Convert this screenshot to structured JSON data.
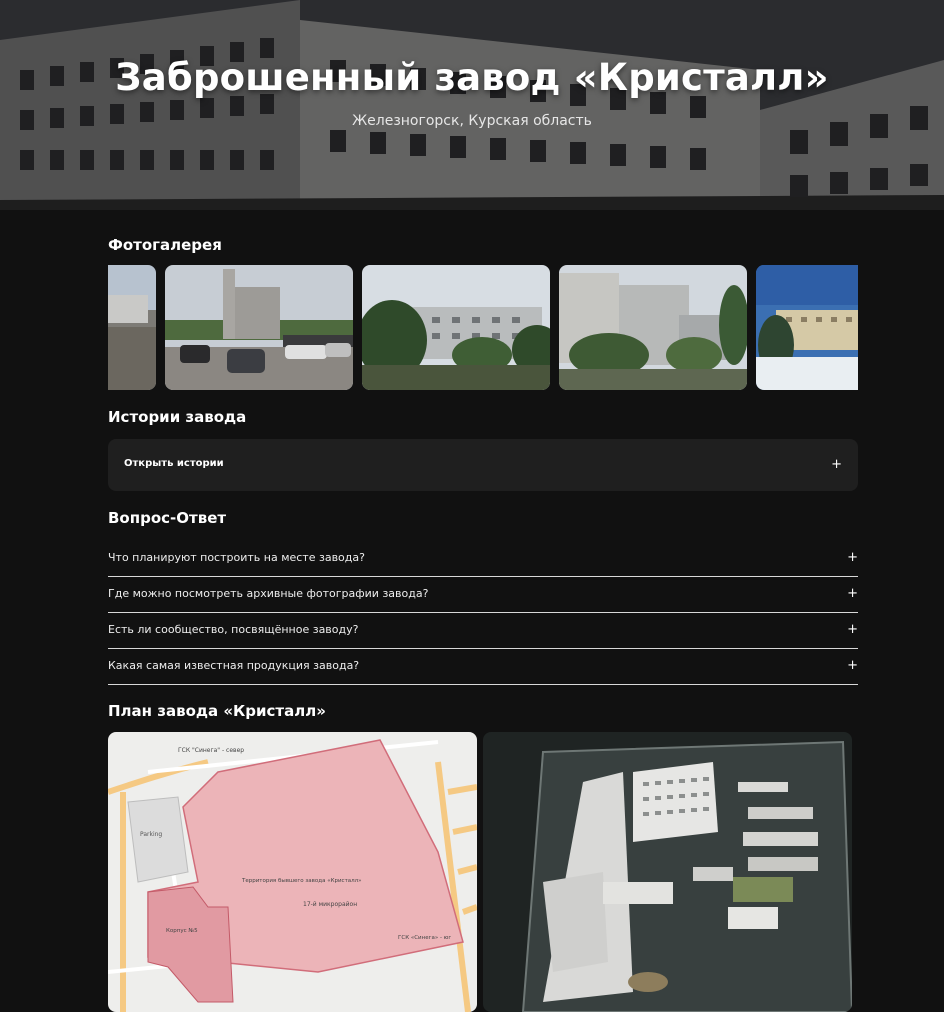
{
  "hero": {
    "title": "Заброшенный завод «Кристалл»",
    "subtitle": "Железногорск, Курская область"
  },
  "gallery": {
    "title": "Фотогалерея",
    "photos": [
      "factory-ruins-photo",
      "parking-rubble-photo",
      "factory-panorama-photo",
      "factory-bushes-photo",
      "factory-winter-photo"
    ]
  },
  "stories": {
    "title": "Истории завода",
    "open_label": "Открыть истории",
    "toggle": "+"
  },
  "faq": {
    "title": "Вопрос-Ответ",
    "items": [
      {
        "question": "Что планируют построить на месте завода?",
        "toggle": "+"
      },
      {
        "question": "Где можно посмотреть архивные фотографии завода?",
        "toggle": "+"
      },
      {
        "question": "Есть ли сообщество, посвящённое заводу?",
        "toggle": "+"
      },
      {
        "question": "Какая самая известная продукция завода?",
        "toggle": "+"
      }
    ]
  },
  "plan": {
    "title": "План завода «Кристалл»",
    "map_labels": {
      "north": "ГСК \"Синега\" - север",
      "parking": "Parking",
      "territory": "Территория бывшего завода «Кристалл»",
      "district": "17-й микрорайон",
      "building": "Корпус №5",
      "south": "ГСК «Синега» - юг"
    }
  }
}
